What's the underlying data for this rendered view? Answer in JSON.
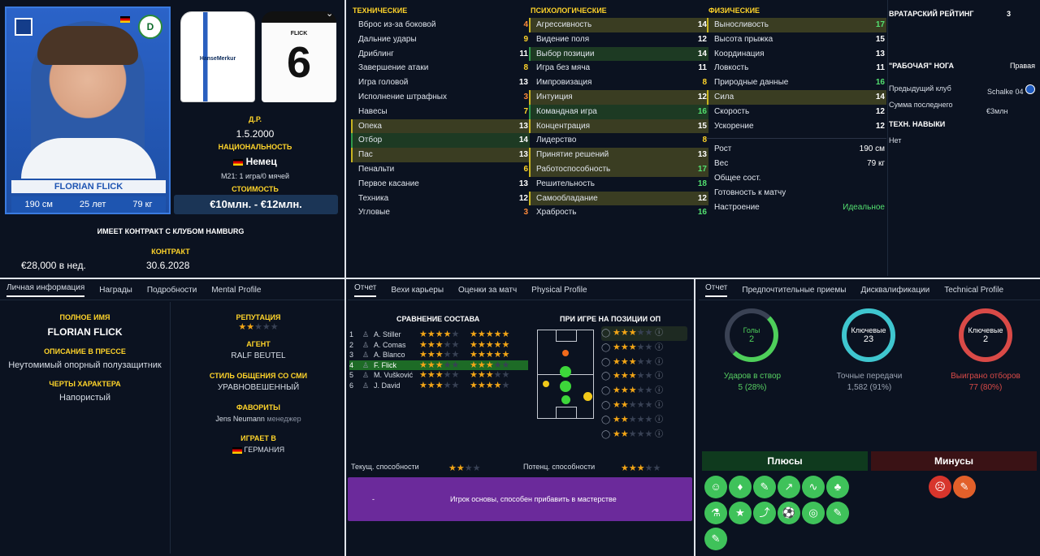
{
  "player": {
    "name_card": "FLORIAN FLICK",
    "height": "190 см",
    "age": "25 лет",
    "weight": "79 кг",
    "dob_label": "Д.Р.",
    "dob": "1.5.2000",
    "nat_label": "НАЦИОНАЛЬНОСТЬ",
    "nat": "Немец",
    "u21": "M21: 1 игра/0 мячей",
    "value_label": "СТОИМОСТЬ",
    "value": "€10млн. - €12млн.",
    "contract_text": "ИМЕЕТ КОНТРАКТ С КЛУБОМ HAMBURG",
    "contract_label": "КОНТРАКТ",
    "wage": "€28,000 в нед.",
    "contract_end": "30.6.2028",
    "kit_back_name": "FLICK",
    "kit_number": "6",
    "kit_sponsor": "HanseMerkur"
  },
  "technical": {
    "title": "ТЕХНИЧЕСКИЕ",
    "rows": [
      {
        "name": "Вброс из-за боковой",
        "val": "4",
        "c": "#ff8a3a",
        "hl": ""
      },
      {
        "name": "Дальние удары",
        "val": "9",
        "c": "#ffd42a",
        "hl": ""
      },
      {
        "name": "Дриблинг",
        "val": "11",
        "c": "#fff",
        "hl": ""
      },
      {
        "name": "Завершение атаки",
        "val": "8",
        "c": "#ffd42a",
        "hl": ""
      },
      {
        "name": "Игра головой",
        "val": "13",
        "c": "#fff",
        "hl": ""
      },
      {
        "name": "Исполнение штрафных",
        "val": "3",
        "c": "#ff8a3a",
        "hl": ""
      },
      {
        "name": "Навесы",
        "val": "7",
        "c": "#ffd42a",
        "hl": ""
      },
      {
        "name": "Опека",
        "val": "13",
        "c": "#fff",
        "hl": "hl"
      },
      {
        "name": "Отбор",
        "val": "14",
        "c": "#fff",
        "hl": "gr"
      },
      {
        "name": "Пас",
        "val": "13",
        "c": "#fff",
        "hl": "hl"
      },
      {
        "name": "Пенальти",
        "val": "6",
        "c": "#ffd42a",
        "hl": ""
      },
      {
        "name": "Первое касание",
        "val": "13",
        "c": "#fff",
        "hl": ""
      },
      {
        "name": "Техника",
        "val": "12",
        "c": "#fff",
        "hl": ""
      },
      {
        "name": "Угловые",
        "val": "3",
        "c": "#ff8a3a",
        "hl": ""
      }
    ]
  },
  "mental": {
    "title": "ПСИХОЛОГИЧЕСКИЕ",
    "rows": [
      {
        "name": "Агрессивность",
        "val": "14",
        "c": "#fff",
        "hl": "hl"
      },
      {
        "name": "Видение поля",
        "val": "12",
        "c": "#fff",
        "hl": ""
      },
      {
        "name": "Выбор позиции",
        "val": "14",
        "c": "#fff",
        "hl": "gr"
      },
      {
        "name": "Игра без мяча",
        "val": "11",
        "c": "#fff",
        "hl": ""
      },
      {
        "name": "Импровизация",
        "val": "8",
        "c": "#ffd42a",
        "hl": ""
      },
      {
        "name": "Интуиция",
        "val": "12",
        "c": "#fff",
        "hl": "hl"
      },
      {
        "name": "Командная игра",
        "val": "16",
        "c": "#53e070",
        "hl": "gr"
      },
      {
        "name": "Концентрация",
        "val": "15",
        "c": "#fff",
        "hl": "hl"
      },
      {
        "name": "Лидерство",
        "val": "8",
        "c": "#ffd42a",
        "hl": ""
      },
      {
        "name": "Принятие решений",
        "val": "13",
        "c": "#fff",
        "hl": "hl"
      },
      {
        "name": "Работоспособность",
        "val": "17",
        "c": "#53e070",
        "hl": "hl"
      },
      {
        "name": "Решительность",
        "val": "18",
        "c": "#53e070",
        "hl": ""
      },
      {
        "name": "Самообладание",
        "val": "12",
        "c": "#fff",
        "hl": "hl"
      },
      {
        "name": "Храбрость",
        "val": "16",
        "c": "#53e070",
        "hl": ""
      }
    ]
  },
  "physical": {
    "title": "ФИЗИЧЕСКИЕ",
    "rows": [
      {
        "name": "Выносливость",
        "val": "17",
        "c": "#53e070",
        "hl": "hl"
      },
      {
        "name": "Высота прыжка",
        "val": "15",
        "c": "#fff",
        "hl": ""
      },
      {
        "name": "Координация",
        "val": "13",
        "c": "#fff",
        "hl": ""
      },
      {
        "name": "Ловкость",
        "val": "11",
        "c": "#fff",
        "hl": ""
      },
      {
        "name": "Природные данные",
        "val": "16",
        "c": "#53e070",
        "hl": ""
      },
      {
        "name": "Сила",
        "val": "14",
        "c": "#fff",
        "hl": "hl"
      },
      {
        "name": "Скорость",
        "val": "12",
        "c": "#fff",
        "hl": ""
      },
      {
        "name": "Ускорение",
        "val": "12",
        "c": "#fff",
        "hl": ""
      }
    ],
    "info": [
      {
        "name": "Рост",
        "val": "190 см"
      },
      {
        "name": "Вес",
        "val": "79 кг"
      },
      {
        "name": "Общее сост.",
        "val": ""
      },
      {
        "name": "Готовность к матчу",
        "val": ""
      },
      {
        "name": "Настроение",
        "val": "Идеальное"
      }
    ]
  },
  "right": {
    "gk_label": "ВРАТАРСКИЙ РЕЙТИНГ",
    "gk_val": "3",
    "foot_label": "\"РАБОЧАЯ\" НОГА",
    "foot_val": "Правая",
    "prev_club_label": "Предыдущий клуб",
    "prev_club": "Schalke 04",
    "fee_label": "Сумма последнего",
    "fee": "€3млн",
    "tech_label": "ТЕХН. НАВЫКИ",
    "tech_val": "Нет"
  },
  "bl": {
    "tabs": [
      "Личная информация",
      "Награды",
      "Подробности",
      "Mental Profile"
    ],
    "full_name_label": "ПОЛНОЕ ИМЯ",
    "full_name": "FLORIAN FLICK",
    "press_label": "ОПИСАНИЕ В ПРЕССЕ",
    "press": "Неутомимый опорный полузащитник",
    "traits_label": "ЧЕРТЫ ХАРАКТЕРА",
    "traits": "Напористый",
    "rep_label": "РЕПУТАЦИЯ",
    "agent_label": "АГЕНТ",
    "agent": "RALF BEUTEL",
    "media_label": "СТИЛЬ ОБЩЕНИЯ СО СМИ",
    "media": "УРАВНОВЕШЕННЫЙ",
    "fav_label": "ФАВОРИТЫ",
    "fav": "Jens Neumann",
    "fav_role": "менеджер",
    "plays_label": "ИГРАЕТ В",
    "plays": "ГЕРМАНИЯ"
  },
  "bm": {
    "tabs": [
      "Отчет",
      "Вехи карьеры",
      "Оценки за матч",
      "Physical Profile"
    ],
    "squad_title": "СРАВНЕНИЕ СОСТАВА",
    "pos_title": "ПРИ ИГРЕ НА ПОЗИЦИИ ОП",
    "squad": [
      {
        "n": "1",
        "name": "A. Stiller"
      },
      {
        "n": "2",
        "name": "A. Comas"
      },
      {
        "n": "3",
        "name": "A. Blanco"
      },
      {
        "n": "4",
        "name": "F. Flick"
      },
      {
        "n": "5",
        "name": "M. Vušković"
      },
      {
        "n": "6",
        "name": "J. David"
      }
    ],
    "cur_label": "Текущ. способности",
    "pot_label": "Потенц. способности",
    "dash": "-",
    "summary": "Игрок основы, способен прибавить в мастерстве"
  },
  "br": {
    "tabs": [
      "Отчет",
      "Предпочтительные приемы",
      "Дисквалификации",
      "Technical Profile"
    ],
    "c1_label": "Голы",
    "c1_val": "2",
    "c1_stat": "Ударов в створ",
    "c1_sub": "5 (28%)",
    "c2_label": "Ключевые",
    "c2_val": "23",
    "c2_stat": "Точные передачи",
    "c2_sub": "1,582 (91%)",
    "c3_label": "Ключевые",
    "c3_val": "2",
    "c3_stat": "Выиграно отборов",
    "c3_sub": "77 (80%)",
    "plus_label": "Плюсы",
    "minus_label": "Минусы"
  }
}
